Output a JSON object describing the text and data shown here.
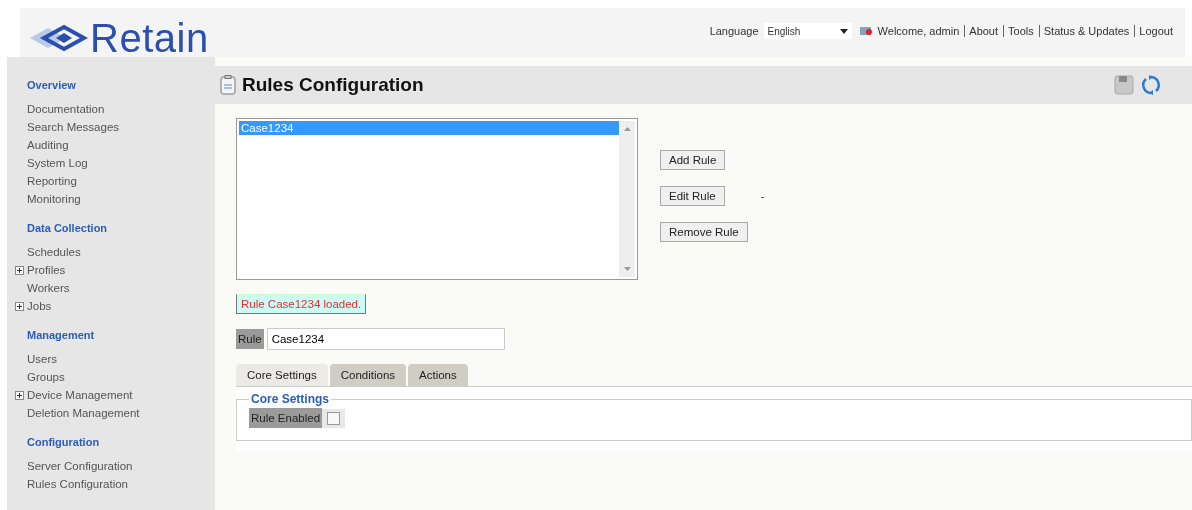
{
  "header": {
    "logo": "Retain",
    "language_label": "Language",
    "language": "English",
    "links": [
      "Welcome, admin",
      "About",
      "Tools",
      "Status & Updates",
      "Logout"
    ]
  },
  "sidebar": {
    "sections": [
      {
        "title": "Overview",
        "items": [
          {
            "label": "Documentation",
            "kind": "plain"
          },
          {
            "label": "Search Messages",
            "kind": "plain"
          },
          {
            "label": "Auditing",
            "kind": "plain"
          },
          {
            "label": "System Log",
            "kind": "plain"
          },
          {
            "label": "Reporting",
            "kind": "plain"
          },
          {
            "label": "Monitoring",
            "kind": "plain"
          }
        ]
      },
      {
        "title": "Data Collection",
        "items": [
          {
            "label": "Schedules",
            "kind": "plain"
          },
          {
            "label": "Profiles",
            "kind": "toggle",
            "expanded": false
          },
          {
            "label": "Workers",
            "kind": "plain"
          },
          {
            "label": "Jobs",
            "kind": "toggle",
            "expanded": false
          }
        ]
      },
      {
        "title": "Management",
        "items": [
          {
            "label": "Users",
            "kind": "plain"
          },
          {
            "label": "Groups",
            "kind": "plain"
          },
          {
            "label": "Device Management",
            "kind": "toggle",
            "expanded": false
          },
          {
            "label": "Deletion Management",
            "kind": "plain"
          }
        ]
      },
      {
        "title": "Configuration",
        "items": [
          {
            "label": "Server Configuration",
            "kind": "plain"
          },
          {
            "label": "Rules Configuration",
            "kind": "plain"
          }
        ]
      }
    ]
  },
  "page": {
    "title": "Rules Configuration",
    "rules_list": [
      {
        "label": "Case1234",
        "selected": true
      }
    ],
    "buttons": [
      "Add Rule",
      "Edit Rule",
      "Remove Rule"
    ],
    "edit_note": "-",
    "status_message": "Rule Case1234 loaded.",
    "rule_label": "Rule",
    "rule_value": "Case1234",
    "tabs": [
      {
        "label": "Core Settings",
        "selected": true
      },
      {
        "label": "Conditions",
        "selected": false
      },
      {
        "label": "Actions",
        "selected": false
      }
    ],
    "group_title": "Core Settings",
    "rule_enabled": {
      "label": "Rule Enabled",
      "checked": false
    }
  }
}
